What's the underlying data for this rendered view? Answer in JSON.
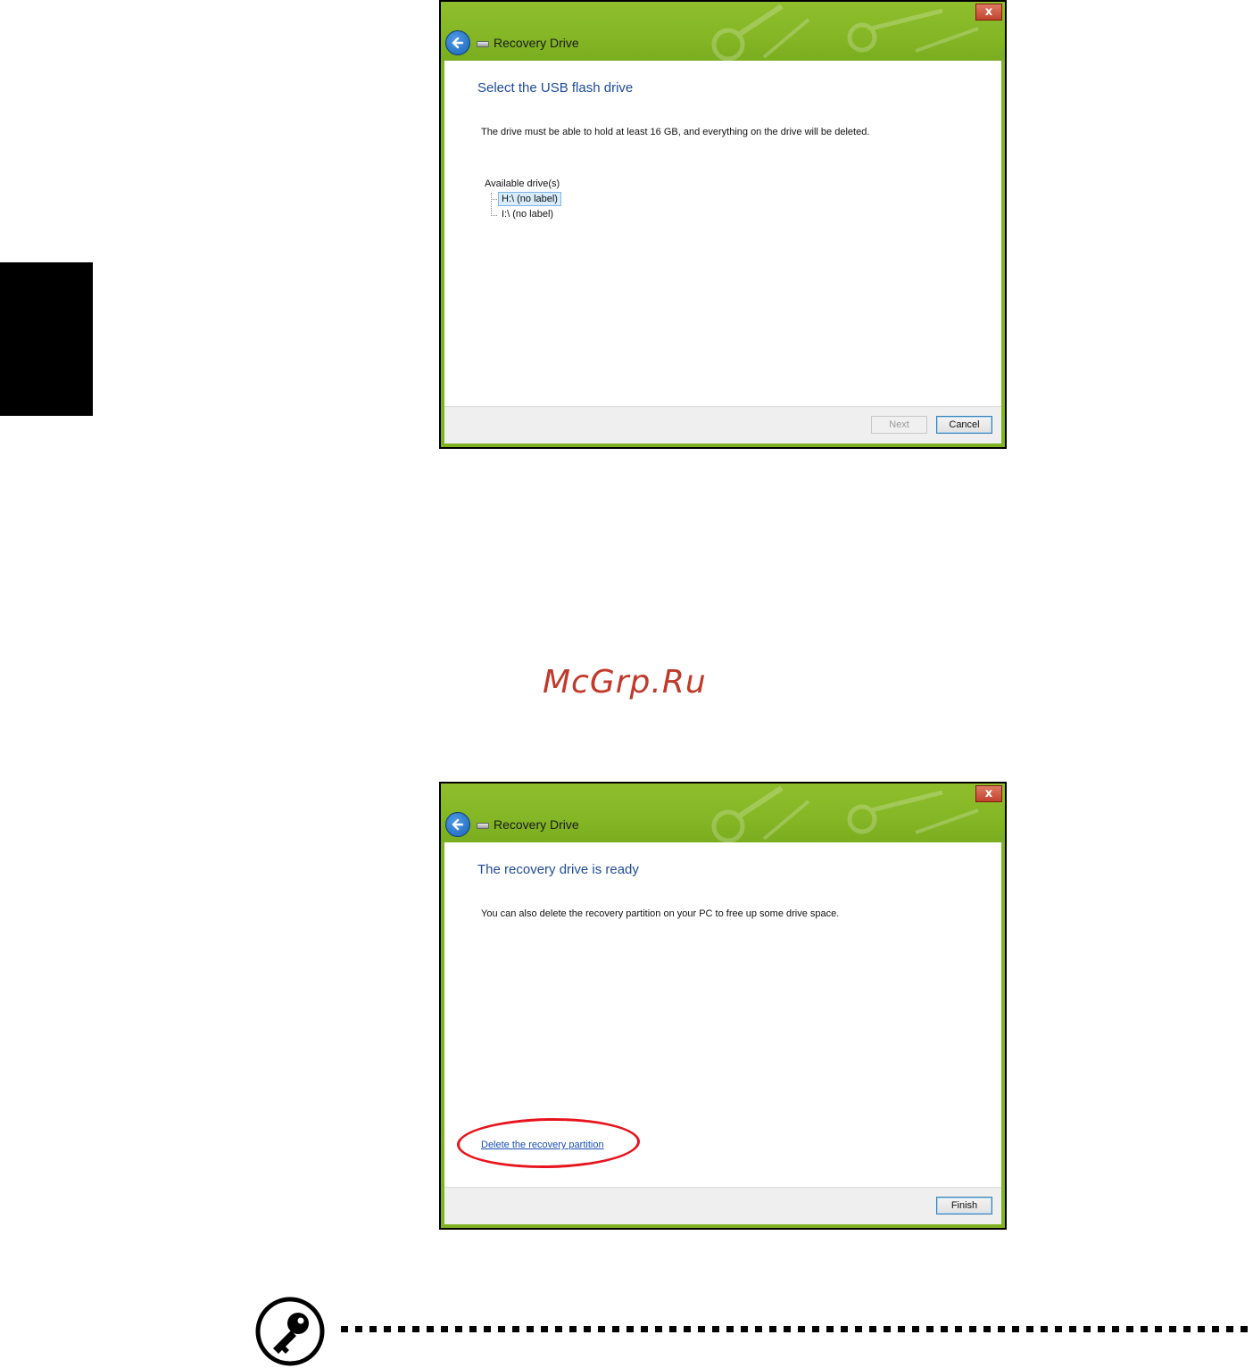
{
  "dialogs": [
    {
      "title": "Recovery Drive",
      "close_label": "x",
      "heading": "Select the USB flash drive",
      "body": "The drive must be able to hold at least 16 GB, and everything on the drive will be deleted.",
      "drives_label": "Available drive(s)",
      "drives": [
        "H:\\ (no label)",
        "I:\\ (no label)"
      ],
      "next_label": "Next",
      "cancel_label": "Cancel"
    },
    {
      "title": "Recovery Drive",
      "close_label": "x",
      "heading": "The recovery drive is ready",
      "body": "You can also delete the recovery partition on your PC to free up some drive space.",
      "link": "Delete the recovery partition",
      "finish_label": "Finish"
    }
  ],
  "watermark": "McGrp.Ru",
  "icons": {
    "back": "back-arrow-icon",
    "drive": "drive-icon",
    "close": "close-icon",
    "note": "key-icon"
  },
  "colors": {
    "titlebar": "#84b625",
    "heading": "#1e4a9a",
    "highlight": "#e8141d",
    "watermark": "#c0392b"
  }
}
